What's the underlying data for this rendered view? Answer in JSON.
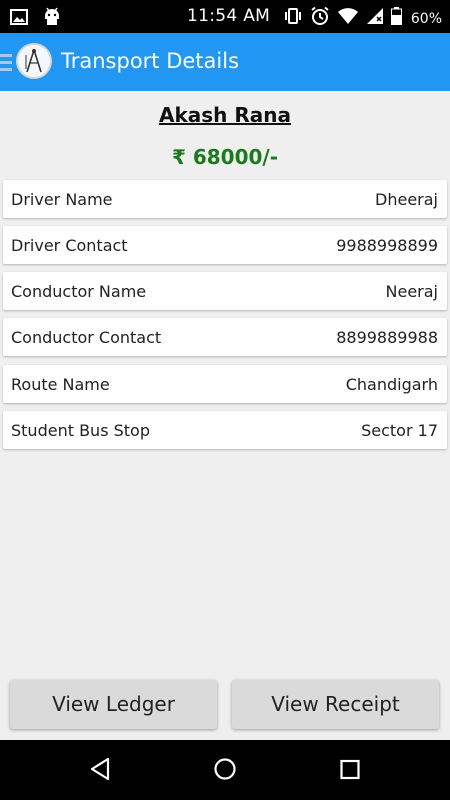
{
  "status_bar": {
    "time": "11:54 AM",
    "battery": "60%",
    "icons": [
      "image-icon",
      "android-icon",
      "vibrate-icon",
      "alarm-icon",
      "wifi-icon",
      "signal-icon",
      "battery-icon"
    ]
  },
  "app_bar": {
    "title": "Transport Details",
    "icons": [
      "menu-icon",
      "app-logo"
    ]
  },
  "student": {
    "name": "Akash Rana",
    "amount": "₹ 68000/-"
  },
  "details": [
    {
      "label": "Driver Name",
      "value": "Dheeraj"
    },
    {
      "label": "Driver Contact",
      "value": "9988998899"
    },
    {
      "label": "Conductor Name",
      "value": "Neeraj"
    },
    {
      "label": "Conductor Contact",
      "value": "8899889988"
    },
    {
      "label": "Route Name",
      "value": "Chandigarh"
    },
    {
      "label": "Student Bus Stop",
      "value": "Sector 17"
    }
  ],
  "buttons": {
    "view_ledger": "View Ledger",
    "view_receipt": "View Receipt"
  },
  "nav_bar": {
    "icons": [
      "back-icon",
      "home-icon",
      "recents-icon"
    ]
  },
  "colors": {
    "app_bar": "#2196f3",
    "amount": "#1b7a1b",
    "background": "#efefef"
  }
}
